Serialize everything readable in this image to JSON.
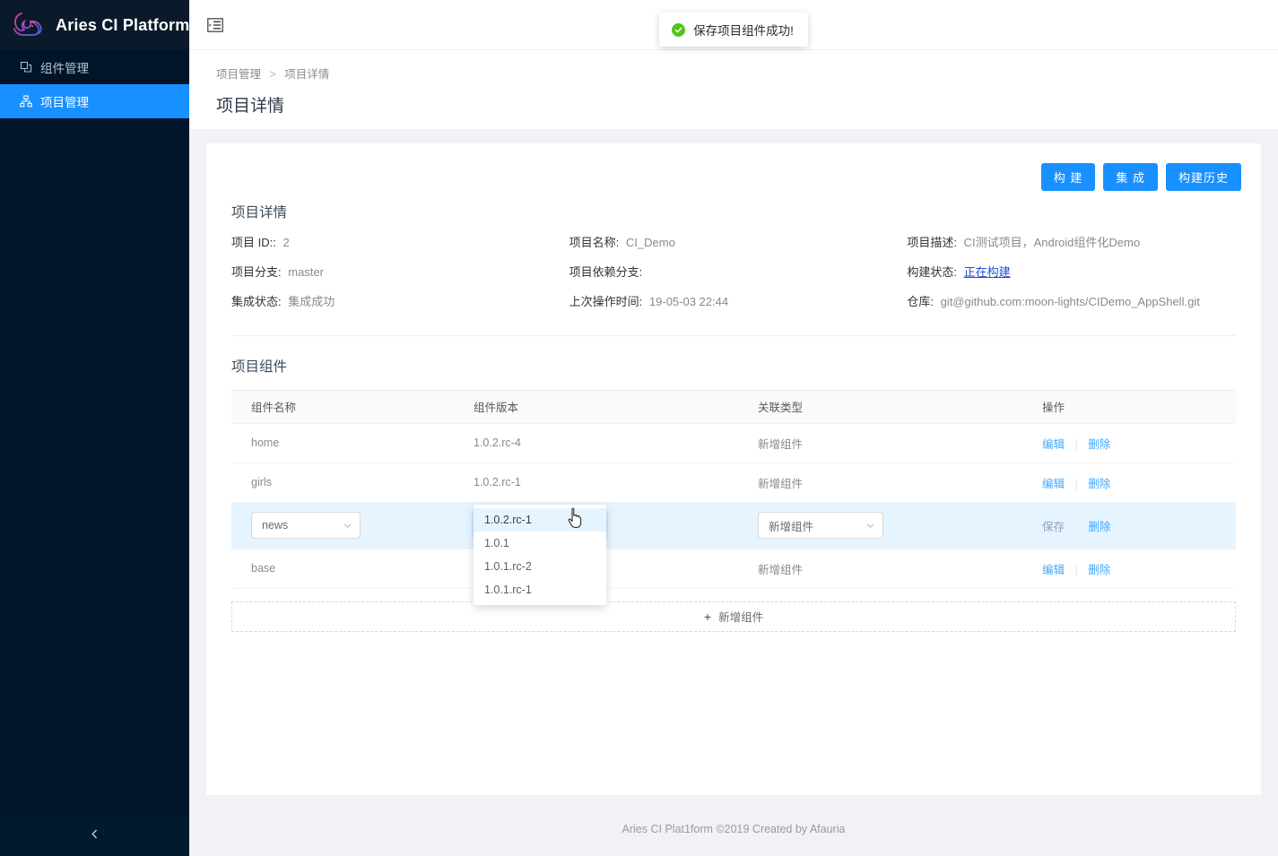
{
  "sidebar": {
    "logo_text": "Aries CI Platform",
    "logo_icon": "aries-ram-head-logo",
    "items": [
      {
        "label": "组件管理",
        "icon": "components-icon",
        "active": false
      },
      {
        "label": "项目管理",
        "icon": "project-icon",
        "active": true
      }
    ],
    "collapse_icon": "chevron-left-icon"
  },
  "topbar": {
    "menu_toggle_icon": "menu-fold-icon",
    "toast": {
      "icon": "check-circle-icon",
      "message": "保存项目组件成功!",
      "color": "#52c41a"
    }
  },
  "page": {
    "breadcrumb": {
      "parent": "项目管理",
      "separator": ">",
      "current": "项目详情"
    },
    "title": "项目详情"
  },
  "actions": {
    "build": "构 建",
    "integrate": "集 成",
    "history": "构建历史",
    "accent_color": "#1890ff"
  },
  "details": {
    "section_title": "项目详情",
    "fields": [
      {
        "label": "项目 ID::",
        "value": "2",
        "link": false
      },
      {
        "label": "项目名称:",
        "value": "CI_Demo",
        "link": false
      },
      {
        "label": "项目描述:",
        "value": "CI测试项目，Android组件化Demo",
        "link": false
      },
      {
        "label": "项目分支:",
        "value": "master",
        "link": false
      },
      {
        "label": "项目依赖分支:",
        "value": "",
        "link": false
      },
      {
        "label": "构建状态:",
        "value": "正在构建",
        "link": true
      },
      {
        "label": "集成状态:",
        "value": "集成成功",
        "link": false
      },
      {
        "label": "上次操作时间:",
        "value": "19-05-03 22:44",
        "link": false
      },
      {
        "label": "仓库:",
        "value": "git@github.com:moon-lights/CIDemo_AppShell.git",
        "link": false
      }
    ]
  },
  "components": {
    "section_title": "项目组件",
    "columns": [
      "组件名称",
      "组件版本",
      "关联类型",
      "操作"
    ],
    "rows": [
      {
        "name": "home",
        "version": "1.0.2.rc-4",
        "type": "新增组件",
        "actions": [
          "编辑",
          "删除"
        ],
        "editing": false
      },
      {
        "name": "girls",
        "version": "1.0.2.rc-1",
        "type": "新增组件",
        "actions": [
          "编辑",
          "删除"
        ],
        "editing": false
      },
      {
        "name": "news",
        "version": "1.0.2.rc-1",
        "type": "新增组件",
        "actions": [
          "保存",
          "删除"
        ],
        "editing": true
      },
      {
        "name": "base",
        "version": "",
        "type": "新增组件",
        "actions": [
          "编辑",
          "删除"
        ],
        "editing": false
      }
    ],
    "version_dropdown": {
      "open": true,
      "selected": "1.0.2.rc-1",
      "options": [
        "1.0.2.rc-1",
        "1.0.1",
        "1.0.1.rc-2",
        "1.0.1.rc-1"
      ]
    },
    "add_button": {
      "icon": "plus-icon",
      "label": "新增组件"
    }
  },
  "footer": {
    "text": "Aries CI Plat1form ©2019 Created by Afauria"
  }
}
